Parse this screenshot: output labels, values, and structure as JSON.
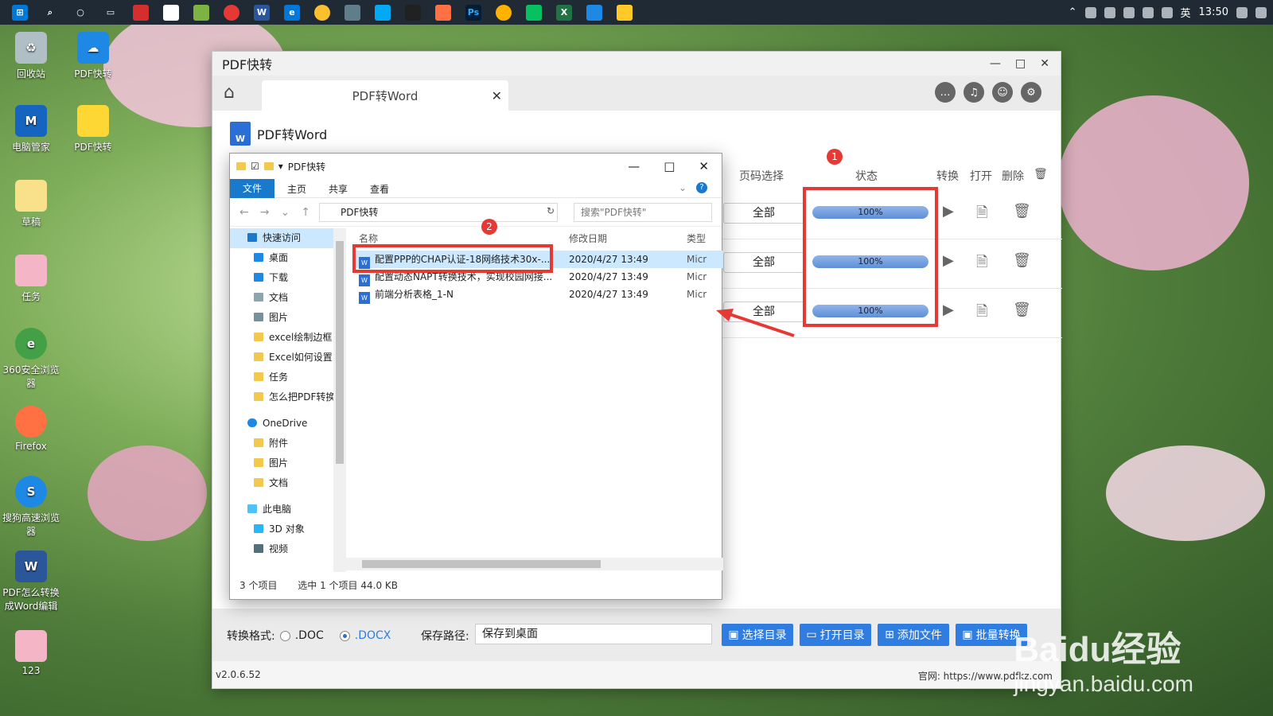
{
  "taskbar": {
    "ime": "英",
    "time": "13:50"
  },
  "desktop_icons": [
    {
      "label": "回收站",
      "icon": "recycle-bin-icon"
    },
    {
      "label": "PDF快转",
      "icon": "pdf-cloud-icon"
    },
    {
      "label": "电脑管家",
      "icon": "pc-manager-icon"
    },
    {
      "label": "PDF快转",
      "icon": "folder-doc-icon"
    },
    {
      "label": "草稿",
      "icon": "drafts-icon"
    },
    {
      "label": "任务",
      "icon": "tasks-icon"
    },
    {
      "label": "360安全浏览器",
      "icon": "browser-360-icon"
    },
    {
      "label": "Firefox",
      "icon": "firefox-icon"
    },
    {
      "label": "搜狗高速浏览器",
      "icon": "sogou-browser-icon"
    },
    {
      "label": "PDF怎么转换成Word编辑",
      "icon": "word-doc-icon"
    },
    {
      "label": "123",
      "icon": "folder-icon"
    }
  ],
  "app": {
    "title": "PDF快转",
    "tab_label": "PDF转Word",
    "heading": "PDF转Word",
    "columns": {
      "page": "页码选择",
      "status": "状态",
      "convert": "转换",
      "open": "打开",
      "delete": "删除"
    },
    "rows": [
      {
        "page": "全部",
        "progress": 1.0,
        "progress_text": "100%"
      },
      {
        "page": "全部",
        "progress": 1.0,
        "progress_text": "100%"
      },
      {
        "page": "全部",
        "progress": 1.0,
        "progress_text": "100%"
      }
    ],
    "format_label": "转换格式:",
    "format_doc": ".DOC",
    "format_docx": ".DOCX",
    "selected_format": ".DOCX",
    "save_label": "保存路径:",
    "save_value": "保存到桌面",
    "buttons": {
      "choose_dir": "选择目录",
      "open_dir": "打开目录",
      "add_file": "添加文件",
      "batch": "批量转换"
    },
    "version": "v2.0.6.52",
    "site": "官网: https://www.pdfkz.com"
  },
  "explorer": {
    "title": "PDF快转",
    "ribbon": [
      "文件",
      "主页",
      "共享",
      "查看"
    ],
    "address": "PDF快转",
    "search_placeholder": "搜索\"PDF快转\"",
    "sidebar": [
      {
        "label": "快速访问",
        "type": "quick"
      },
      {
        "label": "桌面",
        "type": "desktop"
      },
      {
        "label": "下载",
        "type": "download"
      },
      {
        "label": "文档",
        "type": "docs"
      },
      {
        "label": "图片",
        "type": "pics"
      },
      {
        "label": "excel绘制边框",
        "type": "folder"
      },
      {
        "label": "Excel如何设置",
        "type": "folder"
      },
      {
        "label": "任务",
        "type": "folder"
      },
      {
        "label": "怎么把PDF转换",
        "type": "folder"
      },
      {
        "label": "OneDrive",
        "type": "onedrive"
      },
      {
        "label": "附件",
        "type": "folder"
      },
      {
        "label": "图片",
        "type": "folder"
      },
      {
        "label": "文档",
        "type": "folder"
      },
      {
        "label": "此电脑",
        "type": "pc"
      },
      {
        "label": "3D 对象",
        "type": "3d"
      },
      {
        "label": "视频",
        "type": "video"
      }
    ],
    "col_name": "名称",
    "col_date": "修改日期",
    "col_type": "类型",
    "files": [
      {
        "name": "配置PPP的CHAP认证-18网络技术30x-...",
        "date": "2020/4/27 13:49",
        "type": "Micr",
        "selected": true
      },
      {
        "name": "配置动态NAPT转换技术，实现校园网接...",
        "date": "2020/4/27 13:49",
        "type": "Micr",
        "selected": false
      },
      {
        "name": "前端分析表格_1-N",
        "date": "2020/4/27 13:49",
        "type": "Micr",
        "selected": false
      }
    ],
    "status_count": "3 个项目",
    "status_selected": "选中 1 个项目  44.0 KB"
  },
  "annotations": {
    "badge1": "1",
    "badge2": "2"
  },
  "watermark": {
    "brand": "Baidu经验",
    "url": "jingyan.baidu.com"
  },
  "colors": {
    "accent": "#2f7de1",
    "highlight": "#e53935",
    "file_tab": "#1979ca"
  }
}
